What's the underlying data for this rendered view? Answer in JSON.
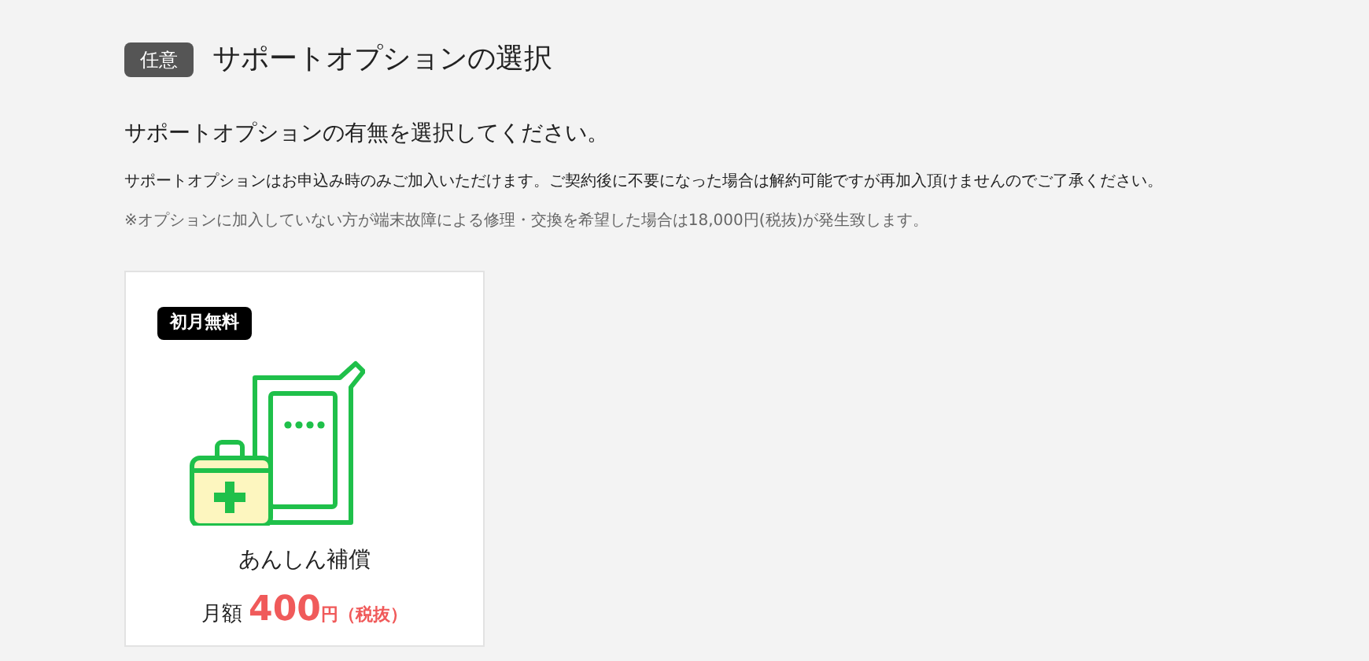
{
  "section": {
    "badge": "任意",
    "title": "サポートオプションの選択"
  },
  "lead": "サポートオプションの有無を選択してください。",
  "notes": [
    {
      "text": "サポートオプションはお申込み時のみご加入いただけます。ご契約後に不要になった場合は解約可能ですが再加入頂けませんのでご了承ください。",
      "kind": "main"
    },
    {
      "text": "※オプションに加入していない方が端末故障による修理・交換を希望した場合は18,000円(税抜)が発生致します。",
      "kind": "muted"
    }
  ],
  "options": [
    {
      "tag": "初月無料",
      "name": "あんしん補償",
      "price_label": "月額",
      "price": "400",
      "unit": "円",
      "tax": "（税抜）"
    }
  ]
}
